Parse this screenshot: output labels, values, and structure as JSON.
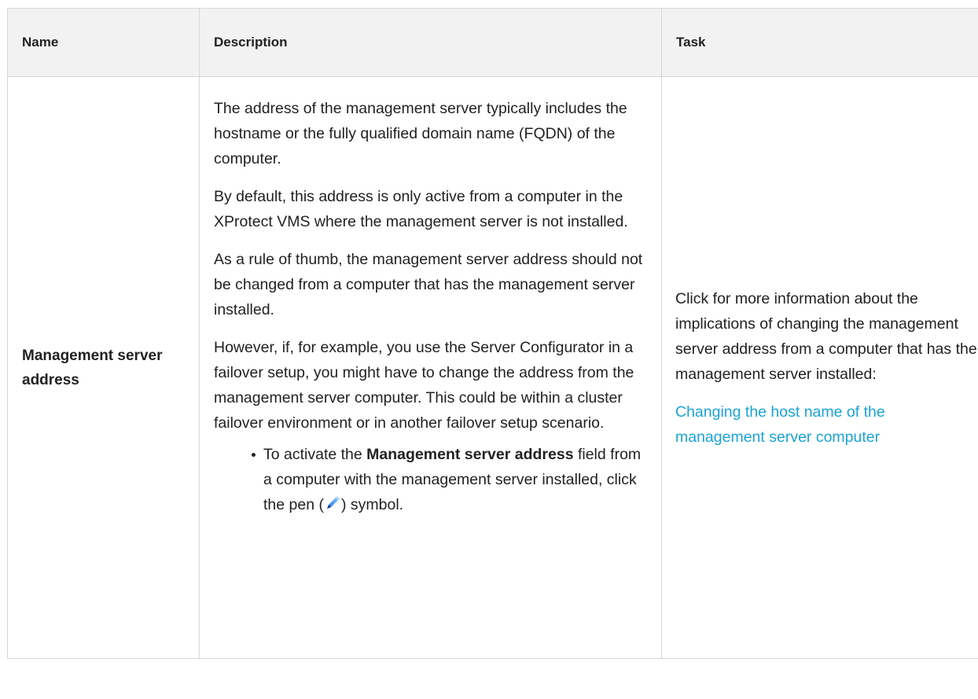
{
  "table": {
    "headers": {
      "name": "Name",
      "description": "Description",
      "task": "Task"
    },
    "row": {
      "name": "Management server address",
      "description": {
        "paragraphs": [
          "The address of the management server typically includes the hostname or the fully qualified domain name (FQDN) of the computer.",
          "By default, this address is only active from a computer in the XProtect VMS where the management server is not installed.",
          "As a rule of thumb, the management server address should not be changed from a computer that has the management server installed.",
          "However, if, for example, you use the Server Configurator in a failover setup, you might have to change the address from the management server computer. This could be within a cluster failover environment or in another failover setup scenario."
        ],
        "bullet": {
          "prefix": "To activate the ",
          "bold": "Management server address",
          "middle": " field from a computer with the management server installed, click the pen (",
          "suffix": ") symbol.",
          "icon": "pen-icon"
        }
      },
      "task": {
        "text": "Click for more information about the implications of changing the management server address from a computer that has the management server installed:",
        "link": "Changing the host name of the management server computer",
        "link_color": "#1aa3d9"
      }
    }
  }
}
